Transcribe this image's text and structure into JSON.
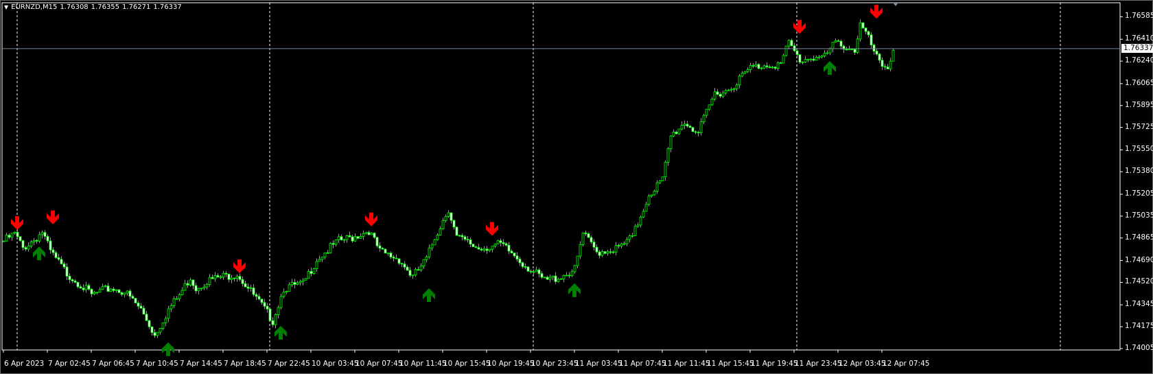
{
  "header": {
    "symbol": "EURNZD,M15",
    "open": "1.76308",
    "high": "1.76355",
    "low": "1.76271",
    "close": "1.76337",
    "menu_icon": "triangle-down-icon"
  },
  "colors": {
    "background": "#000000",
    "candle": "#00ff00",
    "bear_body": "#ffffff",
    "sell_arrow": "#ff0000",
    "buy_arrow": "#008000",
    "grid_separator": "#ffffff",
    "current_price_line": "#7a8a9a"
  },
  "chart_data": {
    "type": "candlestick",
    "title": "EURNZD,M15",
    "timeframe": "M15",
    "current_price": "1.76337",
    "ylim": [
      1.73994,
      1.76694
    ],
    "y_ticks": [
      "1.76585",
      "1.76410",
      "1.76240",
      "1.76065",
      "1.75895",
      "1.75725",
      "1.75550",
      "1.75380",
      "1.75205",
      "1.75035",
      "1.74865",
      "1.74690",
      "1.74520",
      "1.74345",
      "1.74175",
      "1.74005"
    ],
    "x_ticks": [
      "6 Apr 2023",
      "7 Apr 02:45",
      "7 Apr 06:45",
      "7 Apr 10:45",
      "7 Apr 14:45",
      "7 Apr 18:45",
      "7 Apr 22:45",
      "10 Apr 03:45",
      "10 Apr 07:45",
      "10 Apr 11:45",
      "10 Apr 15:45",
      "10 Apr 19:45",
      "10 Apr 23:45",
      "11 Apr 03:45",
      "11 Apr 07:45",
      "11 Apr 11:45",
      "11 Apr 15:45",
      "11 Apr 19:45",
      "11 Apr 23:45",
      "12 Apr 03:45",
      "12 Apr 07:45"
    ],
    "bars_per_tick": 16,
    "bar_count": 325,
    "day_separators_bar_index": [
      5,
      97,
      193,
      289,
      385
    ],
    "close_path": [
      [
        0,
        1.74841
      ],
      [
        4,
        1.74897
      ],
      [
        7,
        1.74785
      ],
      [
        12,
        1.74869
      ],
      [
        14,
        1.74914
      ],
      [
        17,
        1.74757
      ],
      [
        23,
        1.74588
      ],
      [
        28,
        1.74504
      ],
      [
        32,
        1.7442
      ],
      [
        39,
        1.74476
      ],
      [
        44,
        1.74448
      ],
      [
        50,
        1.74308
      ],
      [
        55,
        1.74111
      ],
      [
        60,
        1.74308
      ],
      [
        64,
        1.7442
      ],
      [
        68,
        1.7456
      ],
      [
        70,
        1.74476
      ],
      [
        74,
        1.74532
      ],
      [
        79,
        1.7456
      ],
      [
        85,
        1.74588
      ],
      [
        89,
        1.74476
      ],
      [
        93,
        1.74364
      ],
      [
        98,
        1.74224
      ],
      [
        102,
        1.74476
      ],
      [
        109,
        1.74504
      ],
      [
        114,
        1.747
      ],
      [
        122,
        1.74841
      ],
      [
        127,
        1.74869
      ],
      [
        133,
        1.74925
      ],
      [
        137,
        1.74757
      ],
      [
        144,
        1.747
      ],
      [
        149,
        1.7456
      ],
      [
        154,
        1.747
      ],
      [
        157,
        1.74869
      ],
      [
        162,
        1.75093
      ],
      [
        165,
        1.74869
      ],
      [
        173,
        1.74785
      ],
      [
        181,
        1.74813
      ],
      [
        186,
        1.74729
      ],
      [
        192,
        1.74616
      ],
      [
        197,
        1.74532
      ],
      [
        202,
        1.7456
      ],
      [
        208,
        1.74616
      ],
      [
        211,
        1.74897
      ],
      [
        216,
        1.74757
      ],
      [
        224,
        1.74785
      ],
      [
        229,
        1.74869
      ],
      [
        235,
        1.75205
      ],
      [
        240,
        1.75317
      ],
      [
        243,
        1.75654
      ],
      [
        248,
        1.75766
      ],
      [
        253,
        1.75682
      ],
      [
        259,
        1.7599
      ],
      [
        264,
        1.76018
      ],
      [
        272,
        1.76187
      ],
      [
        278,
        1.76215
      ],
      [
        283,
        1.76215
      ],
      [
        286,
        1.76383
      ],
      [
        290,
        1.76243
      ],
      [
        294,
        1.76271
      ],
      [
        299,
        1.76271
      ],
      [
        303,
        1.76383
      ],
      [
        310,
        1.76327
      ],
      [
        312,
        1.76523
      ],
      [
        315,
        1.76411
      ],
      [
        319,
        1.76215
      ],
      [
        322,
        1.76187
      ],
      [
        324,
        1.76338
      ]
    ],
    "sell_signals": [
      [
        5,
        1.74981
      ],
      [
        18,
        1.75025
      ],
      [
        86,
        1.74644
      ],
      [
        134,
        1.75009
      ],
      [
        178,
        1.74936
      ],
      [
        290,
        1.76506
      ],
      [
        318,
        1.76624
      ]
    ],
    "buy_signals": [
      [
        13,
        1.74745
      ],
      [
        60,
        1.74
      ],
      [
        101,
        1.74128
      ],
      [
        155,
        1.7442
      ],
      [
        208,
        1.74459
      ],
      [
        301,
        1.76187
      ]
    ]
  }
}
